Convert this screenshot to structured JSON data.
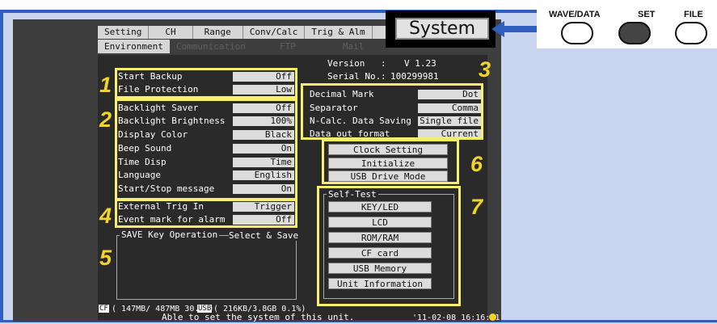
{
  "tabs": [
    "Setting",
    "CH",
    "Range",
    "Conv/Calc",
    "Trig & Alm",
    "System"
  ],
  "subtabs": {
    "environment": "Environment",
    "communication": "Communication",
    "ftp": "FTP",
    "mail": "Mail"
  },
  "system_button": "System",
  "keys": {
    "wave": "WAVE/DATA",
    "set": "SET",
    "file": "FILE"
  },
  "version": {
    "label": "Version",
    "sep": ":",
    "value": "V 1.23"
  },
  "serial": {
    "label": "Serial No.",
    "sep": ":",
    "value": "100299981"
  },
  "settings": [
    {
      "label": "Start Backup",
      "value": "Off"
    },
    {
      "label": "File Protection",
      "value": "Low"
    },
    {
      "label": "Backlight Saver",
      "value": "Off"
    },
    {
      "label": "Backlight Brightness",
      "value": "100%"
    },
    {
      "label": "Display Color",
      "value": "Black"
    },
    {
      "label": "Beep Sound",
      "value": "On"
    },
    {
      "label": "Time Disp",
      "value": "Time"
    },
    {
      "label": "Language",
      "value": "English"
    },
    {
      "label": "Start/Stop message",
      "value": "On"
    },
    {
      "label": "External Trig In",
      "value": "Trigger"
    },
    {
      "label": "Event mark for alarm",
      "value": "Off"
    }
  ],
  "right_settings": [
    {
      "label": "Decimal Mark",
      "value": "Dot"
    },
    {
      "label": "Separator",
      "value": "Comma"
    },
    {
      "label": "N-Calc. Data Saving",
      "value": "Single file"
    },
    {
      "label": "Data out format",
      "value": "Current"
    }
  ],
  "clock_buttons": [
    "Clock Setting",
    "Initialize",
    "USB Drive Mode"
  ],
  "self_test": {
    "title": "Self-Test",
    "buttons": [
      "KEY/LED",
      "LCD",
      "ROM/RAM",
      "CF card",
      "USB Memory",
      "Unit Information"
    ]
  },
  "save_key": {
    "title": "SAVE Key Operation",
    "value": "Select & Save"
  },
  "numbers": [
    "1",
    "2",
    "3",
    "4",
    "5",
    "6",
    "7"
  ],
  "status": {
    "cf_icon": "CF",
    "cf": "( 147MB/ 487MB 30.2%)",
    "usb_icon": "USB",
    "usb": "( 216KB/3.8GB  0.1%)",
    "message": "Able to set the system of this unit.",
    "datetime": "'11-02-08 16:16:41"
  },
  "colors": {
    "highlight": "#f7ef6a",
    "callout": "#f2d524",
    "arrow": "#2f5fbf"
  }
}
